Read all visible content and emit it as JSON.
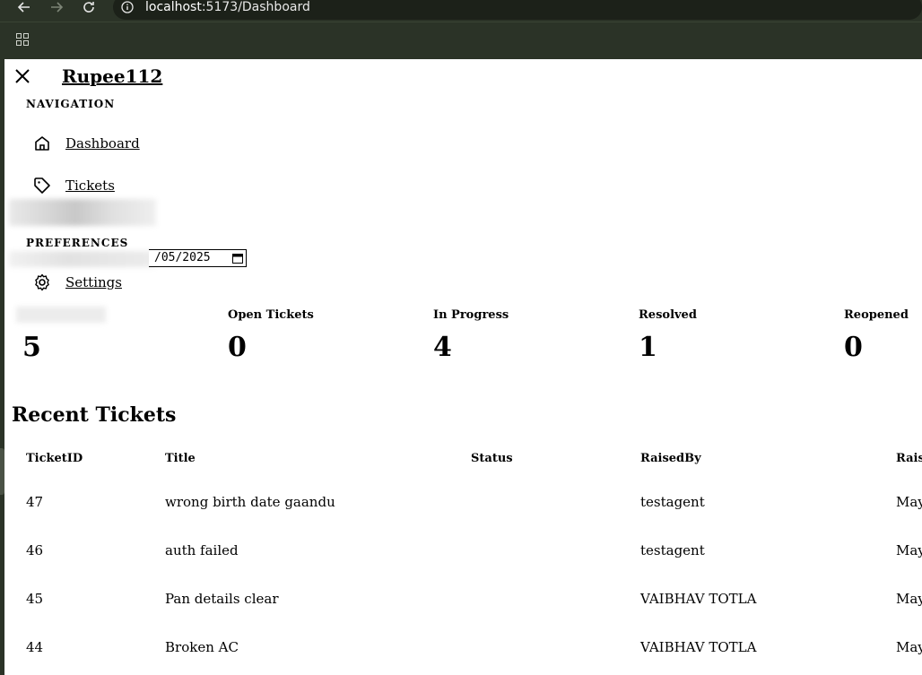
{
  "browser": {
    "url_host": "localhost",
    "url_path": ":5173/Dashboard"
  },
  "sidebar": {
    "brand": "Rupee112",
    "nav_section": "NAVIGATION",
    "items": [
      {
        "label": "Dashboard",
        "icon": "home-icon"
      },
      {
        "label": "Tickets",
        "icon": "tag-icon"
      }
    ],
    "pref_section": "PREFERENCES",
    "settings_label": "Settings"
  },
  "filter": {
    "date_value": "/05/2025"
  },
  "stats": [
    {
      "label": "",
      "value": "5"
    },
    {
      "label": "Open Tickets",
      "value": "0"
    },
    {
      "label": "In Progress",
      "value": "4"
    },
    {
      "label": "Resolved",
      "value": "1"
    },
    {
      "label": "Reopened",
      "value": "0"
    }
  ],
  "recent": {
    "title": "Recent Tickets",
    "columns": [
      "TicketID",
      "Title",
      "Status",
      "RaisedBy",
      "Raise"
    ],
    "rows": [
      {
        "id": "47",
        "title": "wrong birth date gaandu",
        "status": "",
        "raised_by": "testagent",
        "raised": "May"
      },
      {
        "id": "46",
        "title": "auth failed",
        "status": "",
        "raised_by": "testagent",
        "raised": "May"
      },
      {
        "id": "45",
        "title": "Pan details clear",
        "status": "",
        "raised_by": "VAIBHAV TOTLA",
        "raised": "May"
      },
      {
        "id": "44",
        "title": "Broken AC",
        "status": "",
        "raised_by": "VAIBHAV TOTLA",
        "raised": "May"
      }
    ]
  }
}
